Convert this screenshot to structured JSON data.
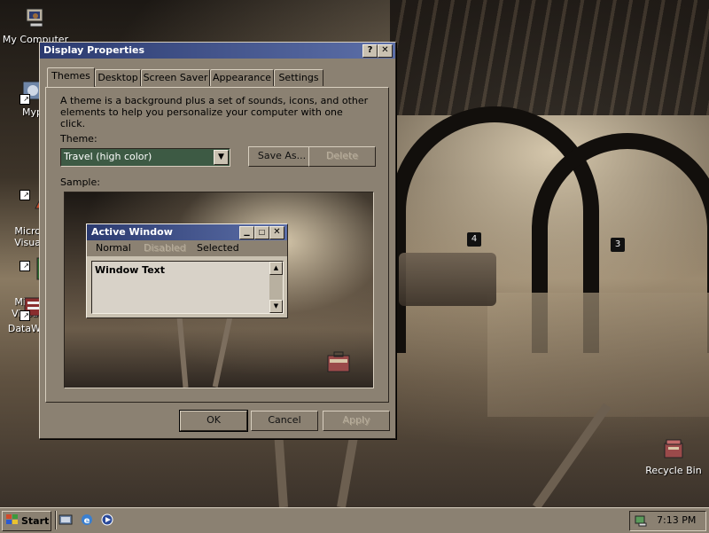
{
  "desktop": {
    "icons": [
      {
        "label": "My Computer",
        "icon": "computer-icon"
      },
      {
        "label": "Myp",
        "icon": "shortcut-icon"
      },
      {
        "label": "Micro\nVisua",
        "icon": "visual-studio-icon"
      },
      {
        "label": "Micro\nVisual",
        "icon": "visual-studio-icon"
      },
      {
        "label": "DataW",
        "icon": "datawindow-icon"
      },
      {
        "label": "Recycle Bin",
        "icon": "recycle-bin-icon"
      }
    ]
  },
  "dialog": {
    "title": "Display Properties",
    "help_btn": "?",
    "close_btn": "✕",
    "tabs": [
      "Themes",
      "Desktop",
      "Screen Saver",
      "Appearance",
      "Settings"
    ],
    "description": "A theme is a background plus a set of sounds, icons, and other elements to help you personalize your computer with one click.",
    "theme_label": "Theme:",
    "theme_value": "Travel (high color)",
    "save_as": "Save As...",
    "delete": "Delete",
    "sample_label": "Sample:",
    "ok": "OK",
    "cancel": "Cancel",
    "apply": "Apply"
  },
  "sample": {
    "title": "Active Window",
    "menu": [
      "Normal",
      "Disabled",
      "Selected"
    ],
    "window_text": "Window Text"
  },
  "taskbar": {
    "start_label": "Start",
    "quicklaunch": [
      "desktop-icon",
      "ie-icon",
      "media-player-icon"
    ],
    "time": "7:13 PM"
  },
  "colors": {
    "titlebar_start": "#2b3a6f",
    "titlebar_end": "#5c6fa8",
    "face": "#8b8172",
    "dropdown_bg": "#3d5a44"
  }
}
